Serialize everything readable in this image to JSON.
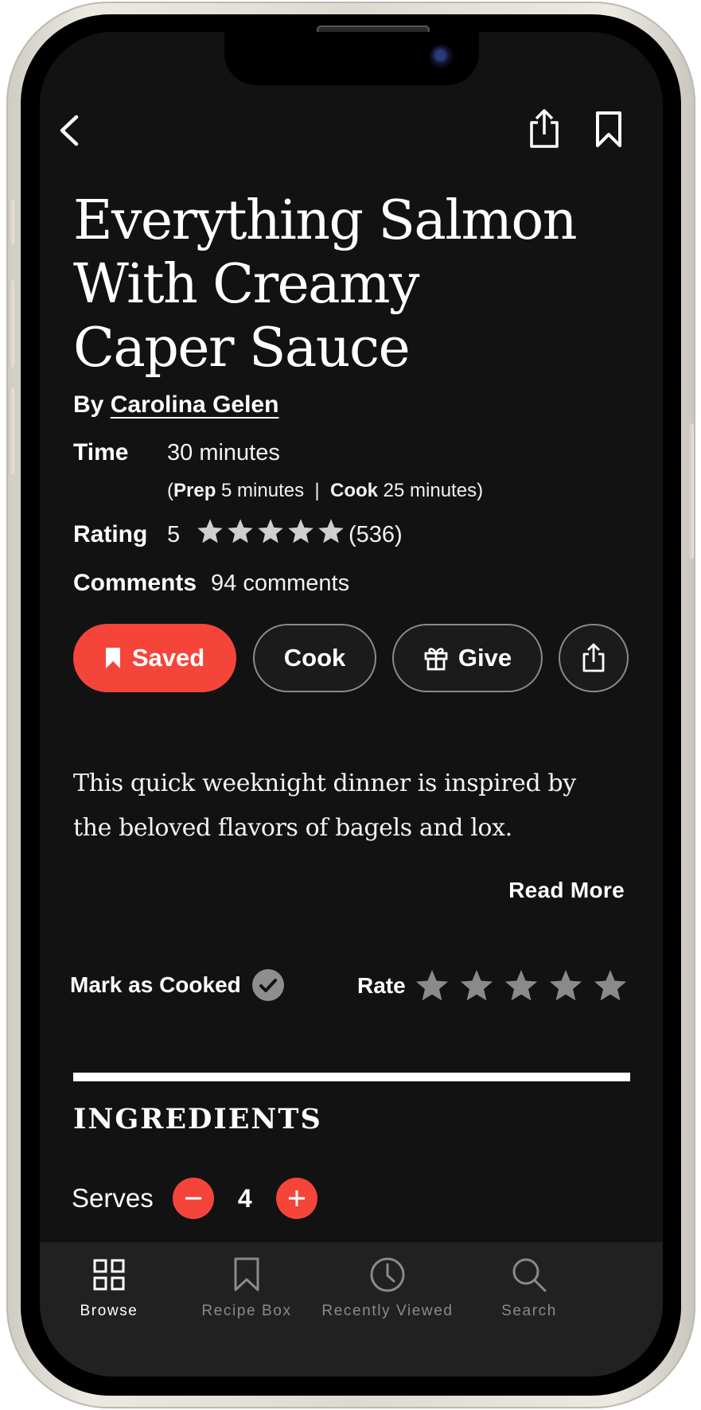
{
  "recipe": {
    "title": "Everything Salmon With Creamy Caper Sauce",
    "byline_prefix": "By",
    "author": "Carolina Gelen",
    "time_label": "Time",
    "time_value": "30 minutes",
    "prep_label": "Prep",
    "prep_value": "5 minutes",
    "cook_label": "Cook",
    "cook_value": "25 minutes",
    "rating_label": "Rating",
    "rating_value": "5",
    "rating_stars": 5,
    "rating_count": "(536)",
    "comments_label": "Comments",
    "comments_value": "94 comments",
    "description": "This quick weeknight dinner is inspired by the beloved flavors of bagels and lox.",
    "read_more": "Read More"
  },
  "actions": {
    "saved": "Saved",
    "cook": "Cook",
    "give": "Give"
  },
  "feedback": {
    "mark_cooked": "Mark as Cooked",
    "rate": "Rate",
    "rate_stars": 5
  },
  "ingredients": {
    "heading": "INGREDIENTS",
    "serves_label": "Serves",
    "serves_count": "4"
  },
  "tabs": [
    {
      "label": "Browse",
      "icon": "grid-icon",
      "active": true
    },
    {
      "label": "Recipe Box",
      "icon": "bookmark-icon",
      "active": false
    },
    {
      "label": "Recently Viewed",
      "icon": "clock-icon",
      "active": false
    },
    {
      "label": "Search",
      "icon": "search-icon",
      "active": false
    }
  ],
  "colors": {
    "accent": "#f5453b",
    "background": "#121212",
    "tab_bar": "#212121",
    "inactive_tab": "#8a8a8a"
  }
}
